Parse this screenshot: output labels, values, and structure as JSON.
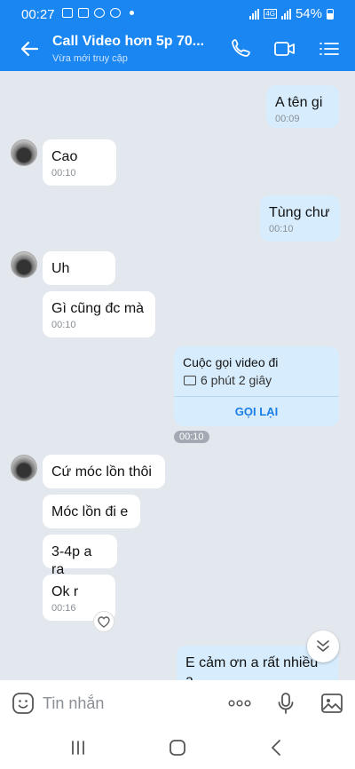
{
  "status": {
    "time": "00:27",
    "battery": "54%",
    "network": "4G"
  },
  "header": {
    "title": "Call Video hơn 5p 70...",
    "subtitle": "Vừa mới truy cập"
  },
  "messages": [
    {
      "text": "A tên gi",
      "time": "00:09"
    },
    {
      "text": "Cao",
      "time": "00:10"
    },
    {
      "text": "Tùng chư",
      "time": "00:10"
    },
    {
      "text": "Uh"
    },
    {
      "text": "Gì cũng đc mà",
      "time": "00:10"
    },
    {
      "text": "Cứ móc lồn thôi"
    },
    {
      "text": "Móc lồn đi e"
    },
    {
      "text": "3-4p a ra"
    },
    {
      "text": "Ok r",
      "time": "00:16"
    },
    {
      "text": "E cảm ơn a rất nhiều ạ"
    }
  ],
  "call": {
    "title": "Cuộc gọi video đi",
    "duration": "6 phút 2 giây",
    "action": "GỌI LẠI",
    "time": "00:10"
  },
  "input": {
    "placeholder": "Tin nhắn"
  },
  "colors": {
    "brand": "#1a86f2",
    "my_bubble": "#d7ecfc",
    "their_bubble": "#ffffff",
    "background": "#e3e8ee"
  }
}
